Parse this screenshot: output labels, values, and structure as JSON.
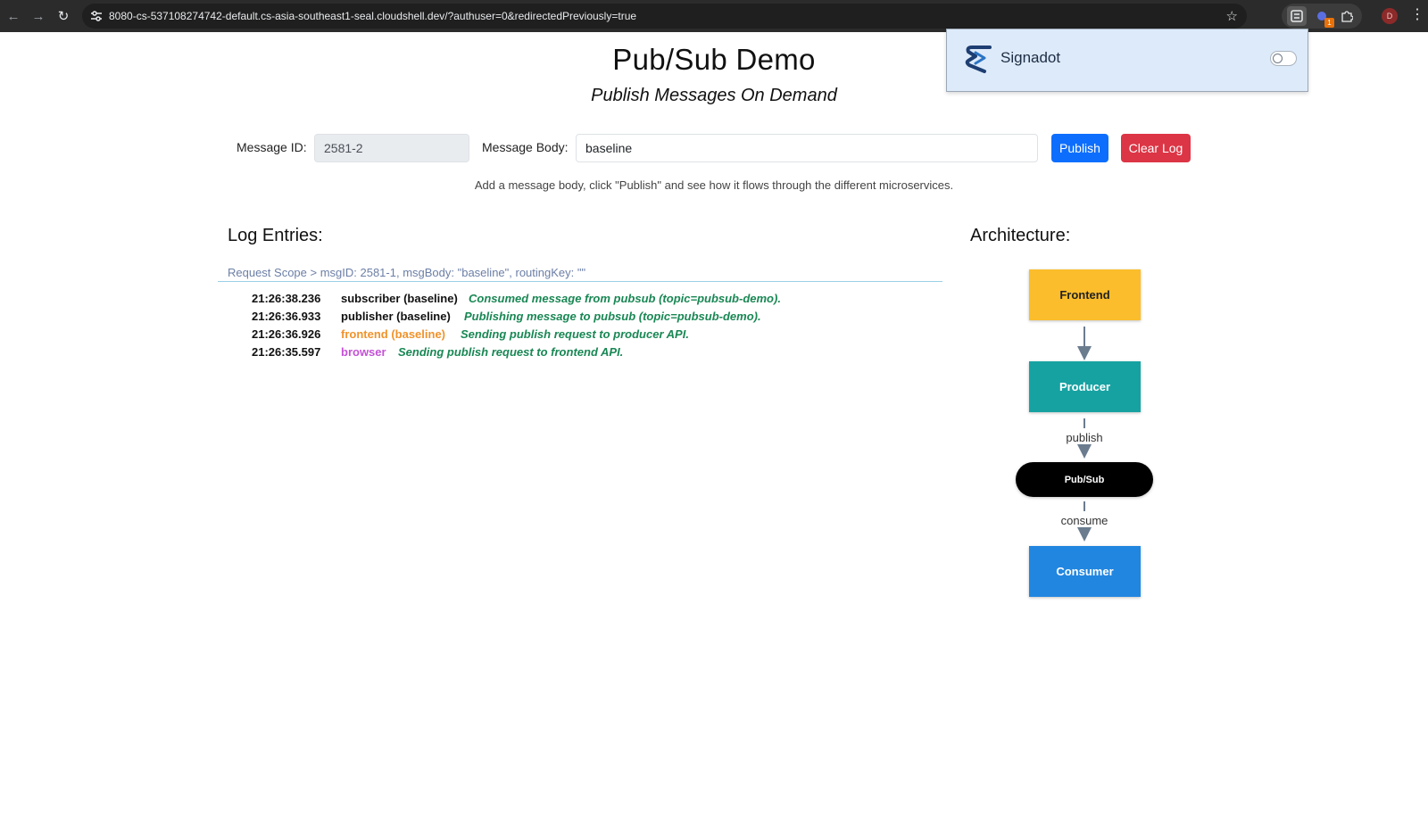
{
  "browser": {
    "url": "8080-cs-537108274742-default.cs-asia-southeast1-seal.cloudshell.dev/?authuser=0&redirectedPreviously=true",
    "profile_initial": "D",
    "ext_badge": "1"
  },
  "page": {
    "title": "Pub/Sub Demo",
    "subtitle": "Publish Messages On Demand"
  },
  "form": {
    "message_id_label": "Message ID:",
    "message_id_value": "2581-2",
    "message_body_label": "Message Body:",
    "message_body_value": "baseline",
    "publish_label": "Publish",
    "clear_label": "Clear Log",
    "hint": "Add a message body, click \"Publish\" and see how it flows through the different microservices."
  },
  "log": {
    "heading": "Log Entries:",
    "scope": "Request Scope > msgID: 2581-1, msgBody: \"baseline\", routingKey: \"\"",
    "entries": [
      {
        "time": "21:26:38.236",
        "service": "subscriber (baseline)",
        "message": "Consumed message from pubsub (topic=pubsub-demo).",
        "service_color": "#111111"
      },
      {
        "time": "21:26:36.933",
        "service": "publisher (baseline)",
        "message": "Publishing message to pubsub (topic=pubsub-demo).",
        "service_color": "#111111"
      },
      {
        "time": "21:26:36.926",
        "service": "frontend (baseline)",
        "message": "Sending publish request to producer API.",
        "service_color": "#f0932b"
      },
      {
        "time": "21:26:35.597",
        "service": "browser",
        "message": "Sending publish request to frontend API.",
        "service_color": "#c452d6"
      }
    ]
  },
  "architecture": {
    "heading": "Architecture:",
    "nodes": {
      "frontend": {
        "label": "Frontend",
        "color": "#fbbd2b"
      },
      "producer": {
        "label": "Producer",
        "color": "#17a2a2"
      },
      "pubsub": {
        "label": "Pub/Sub",
        "color": "#000000"
      },
      "consumer": {
        "label": "Consumer",
        "color": "#2186e0"
      }
    },
    "edges": {
      "publish": "publish",
      "consume": "consume"
    }
  },
  "signadot": {
    "brand": "Signadot",
    "enabled": false
  },
  "colors": {
    "accent": "#0d6efd",
    "danger": "#dc3545",
    "log_message": "#198754"
  }
}
